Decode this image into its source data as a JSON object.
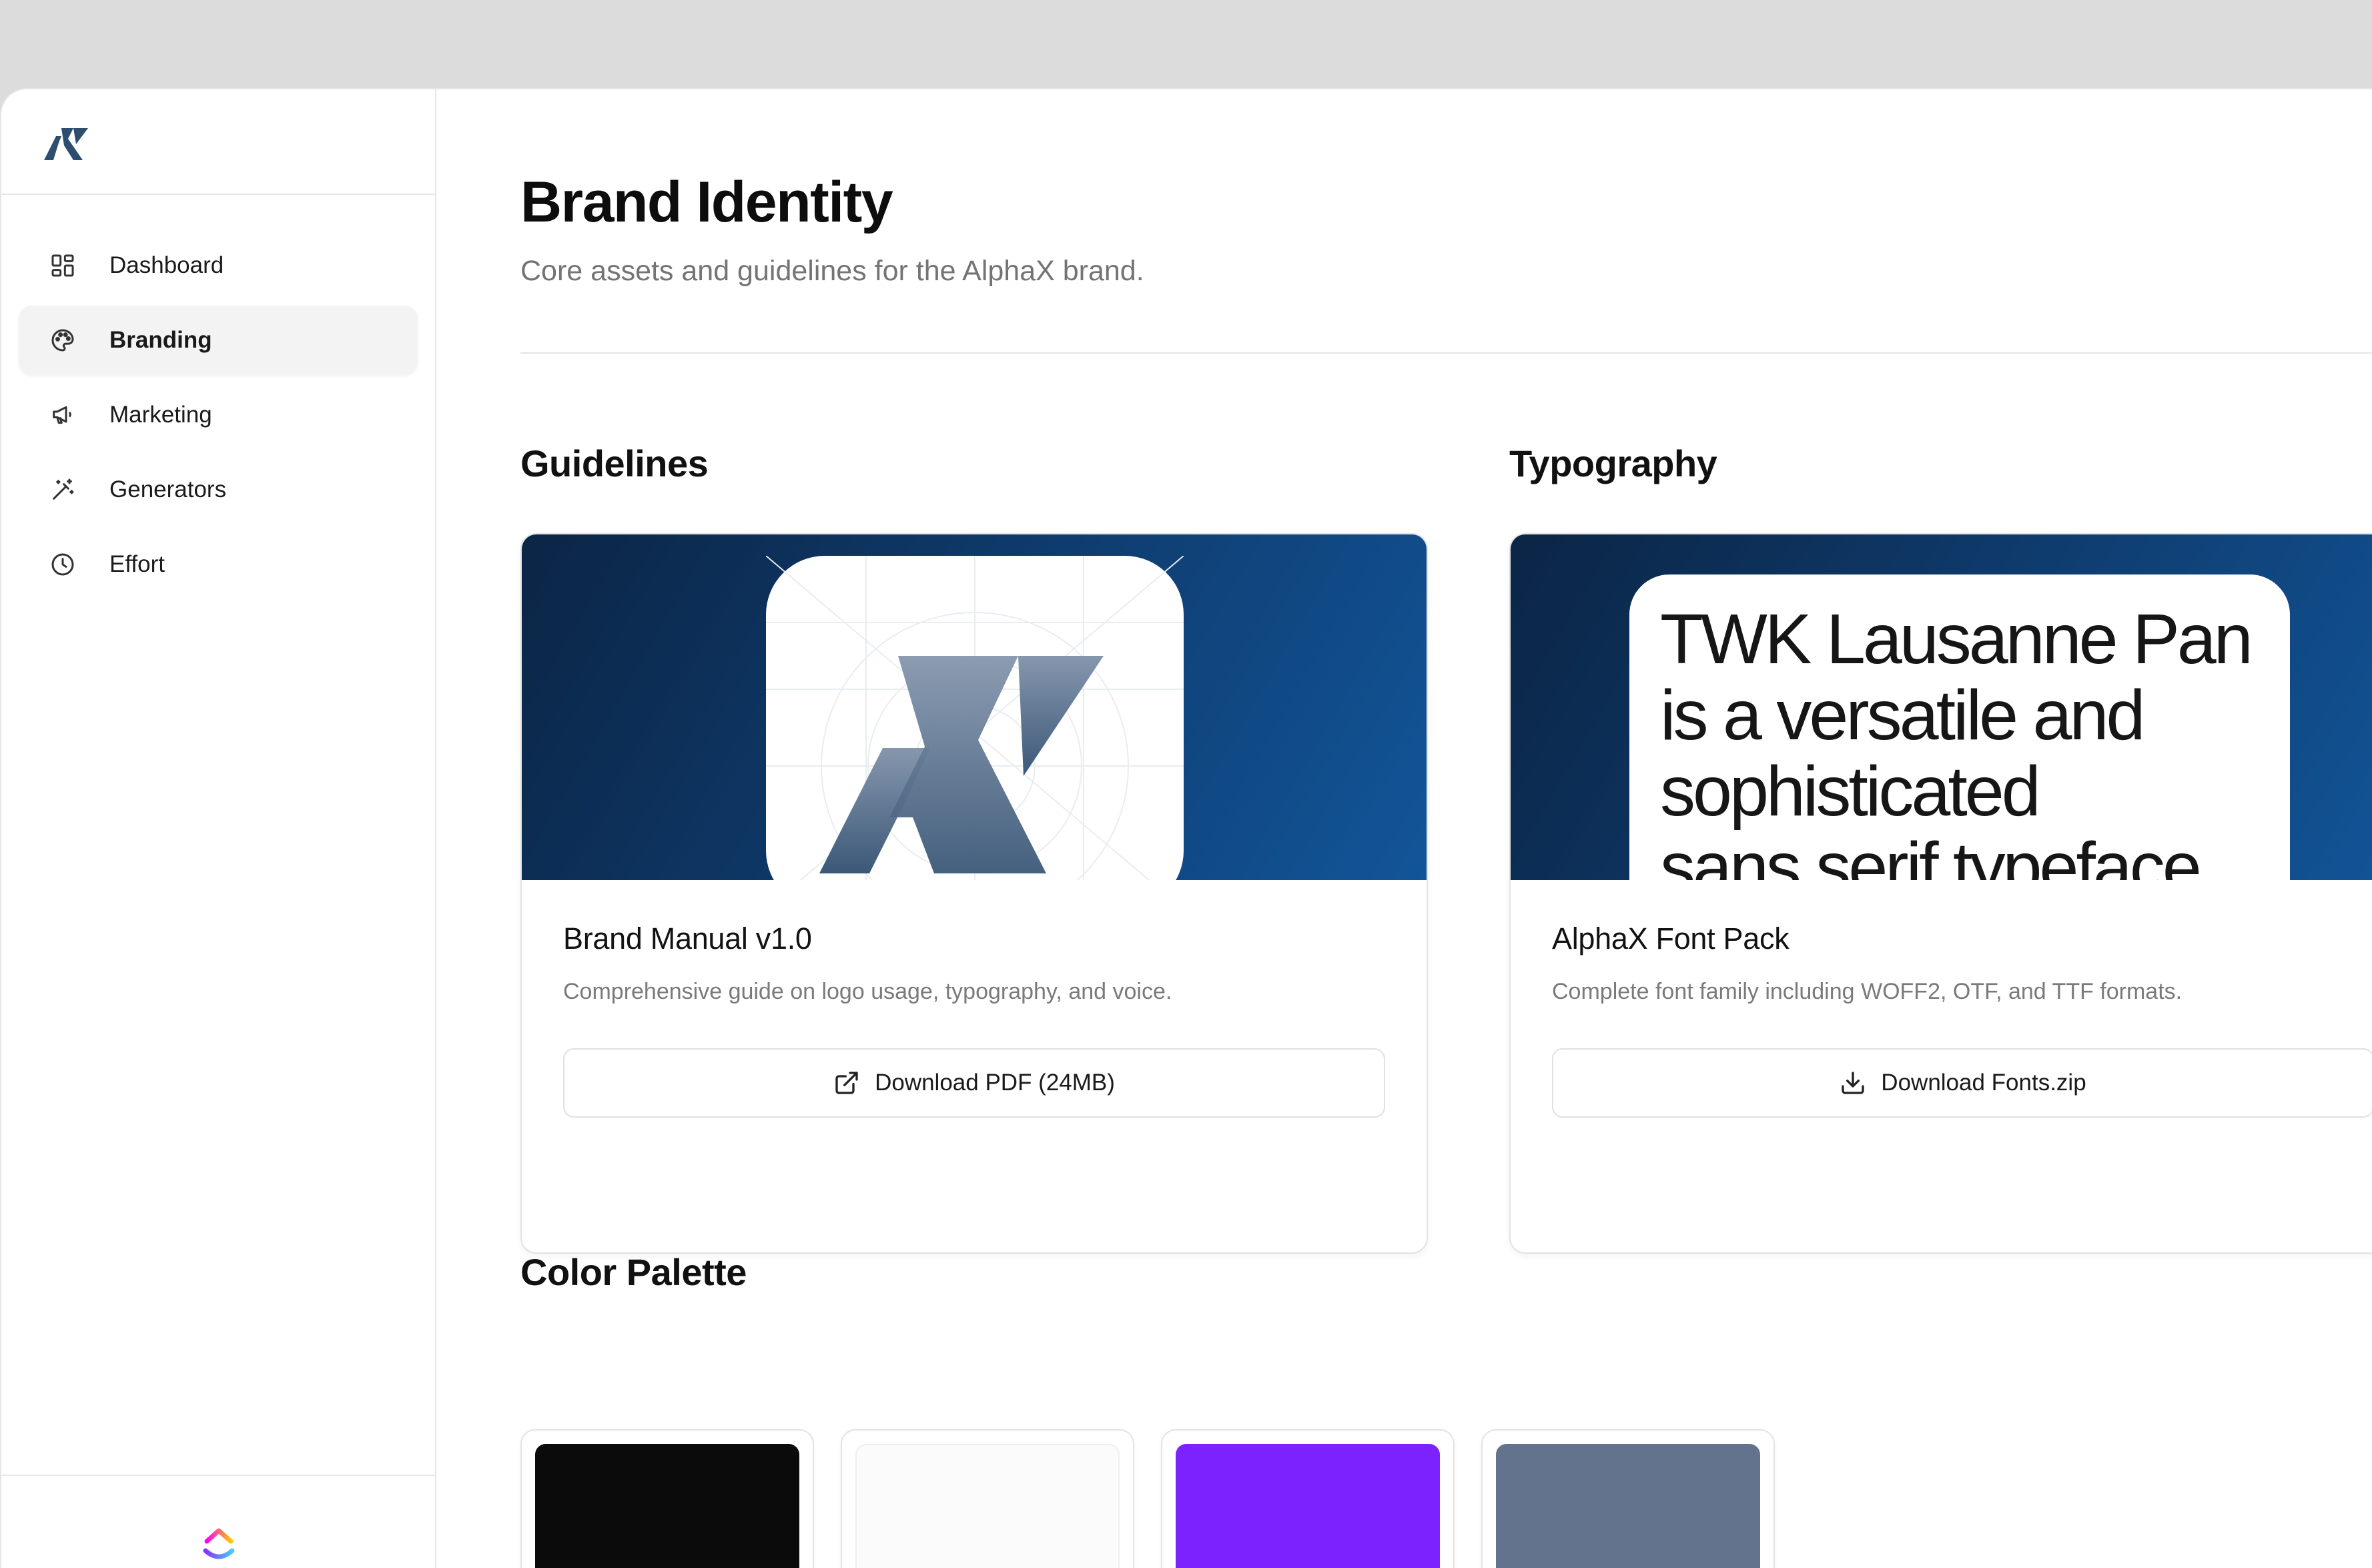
{
  "sidebar": {
    "logo_icon": "alphax-logo-icon",
    "items": [
      {
        "label": "Dashboard",
        "icon": "dashboard-icon",
        "active": false
      },
      {
        "label": "Branding",
        "icon": "palette-icon",
        "active": true
      },
      {
        "label": "Marketing",
        "icon": "megaphone-icon",
        "active": false
      },
      {
        "label": "Generators",
        "icon": "magic-wand-icon",
        "active": false
      },
      {
        "label": "Effort",
        "icon": "clock-icon",
        "active": false
      }
    ],
    "footer_icon": "clickup-icon"
  },
  "header": {
    "title": "Brand Identity",
    "subtitle": "Core assets and guidelines for the AlphaX brand."
  },
  "sections": {
    "guidelines": {
      "title": "Guidelines",
      "card": {
        "title": "Brand Manual v1.0",
        "description": "Comprehensive guide on logo usage, typography, and voice.",
        "button_label": "Download PDF (24MB)",
        "button_icon": "external-link-icon"
      }
    },
    "typography": {
      "title": "Typography",
      "preview_lines": [
        "TWK Lausanne Pan",
        "is a versatile and",
        "sophisticated",
        "sans serif typeface"
      ],
      "card": {
        "title": "AlphaX Font Pack",
        "description": "Complete font family including WOFF2, OTF, and TTF formats.",
        "button_label": "Download Fonts.zip",
        "button_icon": "download-icon"
      }
    },
    "colors": {
      "title": "Color Palette",
      "swatches": [
        "#0b0b0b",
        "#fbfbfb",
        "#7b22fe",
        "#63738e"
      ]
    }
  },
  "colors": {
    "hero_gradient_start": "#0b2545",
    "hero_gradient_end": "#125599",
    "logo_blue": "#2d4e6e"
  }
}
